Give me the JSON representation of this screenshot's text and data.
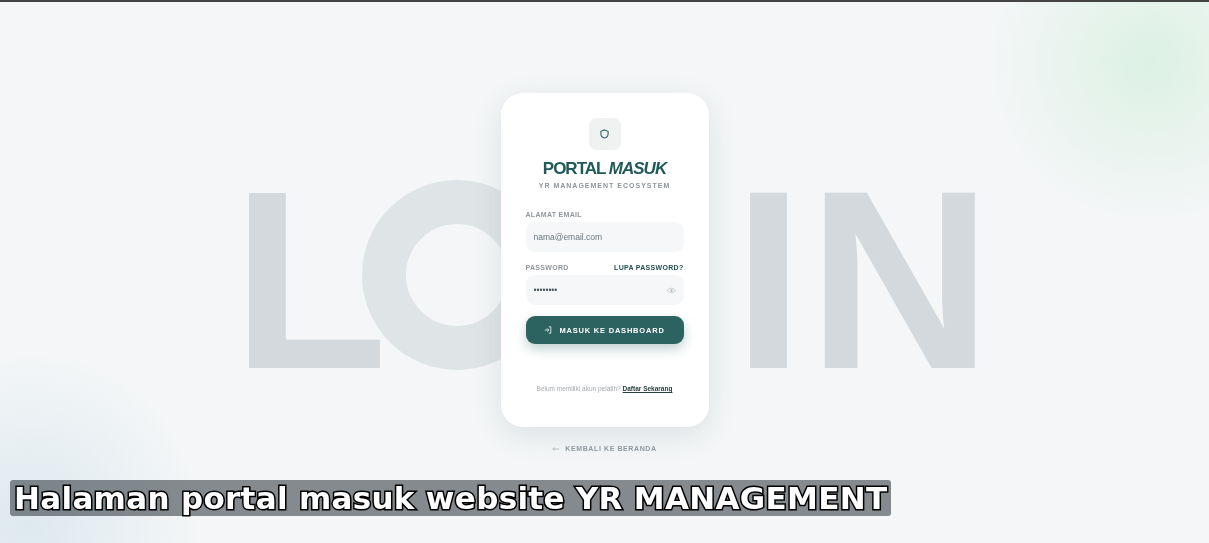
{
  "background_letters": [
    "L",
    "IN"
  ],
  "card": {
    "title": "PORTAL *MASUK*",
    "subtitle": "YR MANAGEMENT ECOSYSTEM",
    "email": {
      "label": "ALAMAT EMAIL",
      "placeholder": "nama@email.com"
    },
    "password": {
      "label": "PASSWORD",
      "forgot_link": "LUPA PASSWORD?",
      "value": "••••••••"
    },
    "submit_button": "MASUK KE DASHBOARD",
    "register_prompt": "Belum memiliki akun pelatih?",
    "register_link": "Daftar Sekarang"
  },
  "back_link": "KEMBALI KE BERANDA",
  "caption": "Halaman portal masuk website YR MANAGEMENT"
}
